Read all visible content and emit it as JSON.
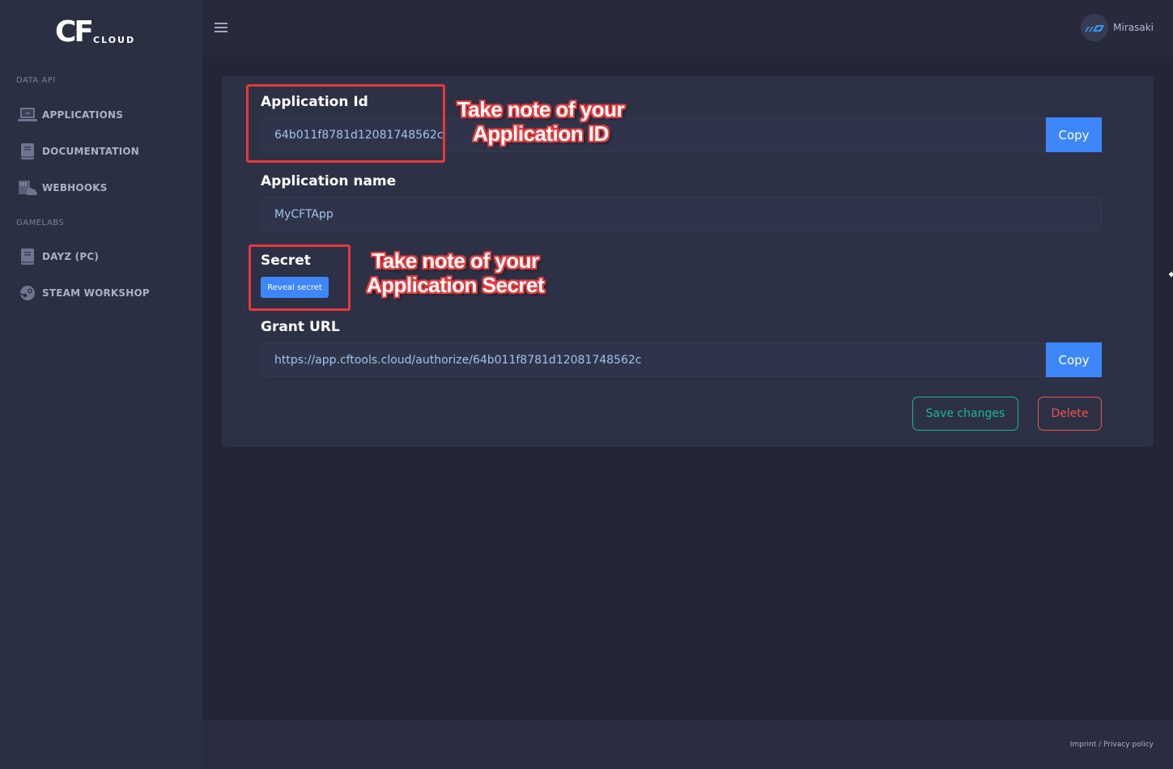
{
  "brand": {
    "logo_mark": "CF",
    "logo_word": "CLOUD"
  },
  "sidebar": {
    "sections": [
      {
        "label": "DATA API",
        "items": [
          {
            "label": "APPLICATIONS",
            "icon": "laptop-code-icon"
          },
          {
            "label": "DOCUMENTATION",
            "icon": "book-icon"
          },
          {
            "label": "WEBHOOKS",
            "icon": "server-cloud-icon"
          }
        ]
      },
      {
        "label": "GAMELABS",
        "items": [
          {
            "label": "DAYZ (PC)",
            "icon": "book-icon"
          },
          {
            "label": "STEAM WORKSHOP",
            "icon": "steam-icon"
          }
        ]
      }
    ]
  },
  "topbar": {
    "menu_icon": "hamburger-icon",
    "user": {
      "name": "Mirasaki",
      "avatar_icon": "user-logo-icon"
    }
  },
  "form": {
    "app_id": {
      "label": "Application Id",
      "value": "64b011f8781d12081748562c",
      "copy_label": "Copy"
    },
    "app_name": {
      "label": "Application name",
      "value": "MyCFTApp"
    },
    "secret": {
      "label": "Secret",
      "reveal_label": "Reveal secret"
    },
    "grant_url": {
      "label": "Grant URL",
      "value": "https://app.cftools.cloud/authorize/64b011f8781d12081748562c",
      "copy_label": "Copy"
    },
    "save_label": "Save changes",
    "delete_label": "Delete"
  },
  "annotations": {
    "app_id_note": [
      "Take note of your",
      "Application ID"
    ],
    "secret_note": [
      "Take note of your",
      "Application Secret"
    ],
    "color": "#e8383b"
  },
  "footer": {
    "imprint": "Imprint",
    "separator": " / ",
    "privacy": "Privacy policy"
  },
  "colors": {
    "primary": "#3d86fc",
    "success": "#17b79a",
    "danger": "#f0524f"
  }
}
